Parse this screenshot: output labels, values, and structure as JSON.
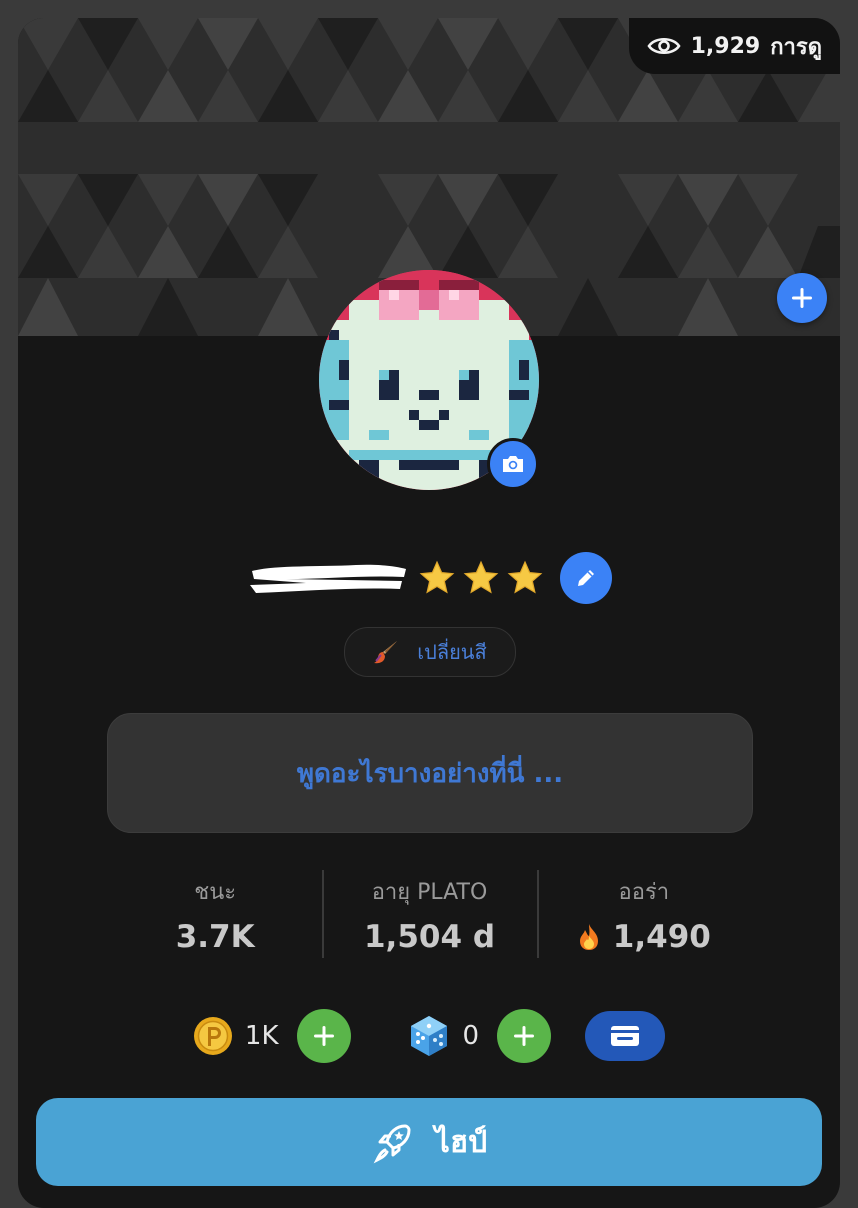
{
  "banner": {
    "views_count": "1,929",
    "views_label": "การดู"
  },
  "profile": {
    "name_redacted": true,
    "stars": 3,
    "change_color_label": "เปลี่ยนสี"
  },
  "status": {
    "placeholder": "พูดอะไรบางอย่างที่นี่ ..."
  },
  "stats": [
    {
      "label": "ชนะ",
      "value": "3.7K"
    },
    {
      "label": "อายุ PLATO",
      "value": "1,504 d"
    },
    {
      "label": "ออร่า",
      "value": "1,490",
      "icon": "fire-icon"
    }
  ],
  "currency": {
    "coins": "1K",
    "dice": "0"
  },
  "actions": {
    "hype_label": "ไฮป์"
  },
  "colors": {
    "accent_blue": "#3b82f6",
    "add_green": "#5ab54a",
    "hype_button": "#4aa3d4",
    "card_bg": "#161616"
  }
}
